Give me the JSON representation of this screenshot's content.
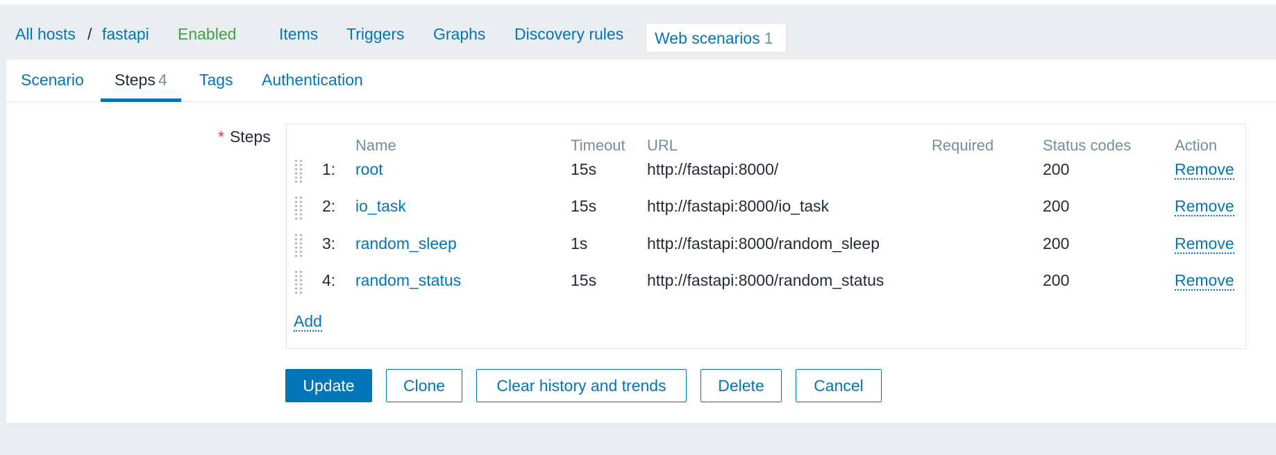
{
  "breadcrumb": {
    "all_hosts": "All hosts",
    "separator": "/",
    "host": "fastapi",
    "status": "Enabled"
  },
  "host_nav": {
    "items": "Items",
    "triggers": "Triggers",
    "graphs": "Graphs",
    "discovery_rules": "Discovery rules",
    "web_scenarios": "Web scenarios",
    "web_scenarios_count": "1"
  },
  "tabs": {
    "scenario": "Scenario",
    "steps": "Steps",
    "steps_count": "4",
    "tags": "Tags",
    "authentication": "Authentication"
  },
  "form": {
    "required_mark": "*",
    "steps_label": "Steps"
  },
  "steps_table": {
    "columns": {
      "name": "Name",
      "timeout": "Timeout",
      "url": "URL",
      "required": "Required",
      "status_codes": "Status codes",
      "action": "Action"
    },
    "rows": [
      {
        "num": "1:",
        "name": "root",
        "timeout": "15s",
        "url": "http://fastapi:8000/",
        "required": "",
        "status_codes": "200",
        "action": "Remove"
      },
      {
        "num": "2:",
        "name": "io_task",
        "timeout": "15s",
        "url": "http://fastapi:8000/io_task",
        "required": "",
        "status_codes": "200",
        "action": "Remove"
      },
      {
        "num": "3:",
        "name": "random_sleep",
        "timeout": "1s",
        "url": "http://fastapi:8000/random_sleep",
        "required": "",
        "status_codes": "200",
        "action": "Remove"
      },
      {
        "num": "4:",
        "name": "random_status",
        "timeout": "15s",
        "url": "http://fastapi:8000/random_status",
        "required": "",
        "status_codes": "200",
        "action": "Remove"
      }
    ],
    "add_label": "Add"
  },
  "buttons": {
    "update": "Update",
    "clone": "Clone",
    "clear_history": "Clear history and trends",
    "delete": "Delete",
    "cancel": "Cancel"
  },
  "colors": {
    "accent": "#0275b8",
    "enabled": "#429e47",
    "required": "#e33734",
    "muted": "#768d99",
    "background": "#ebeef0"
  }
}
